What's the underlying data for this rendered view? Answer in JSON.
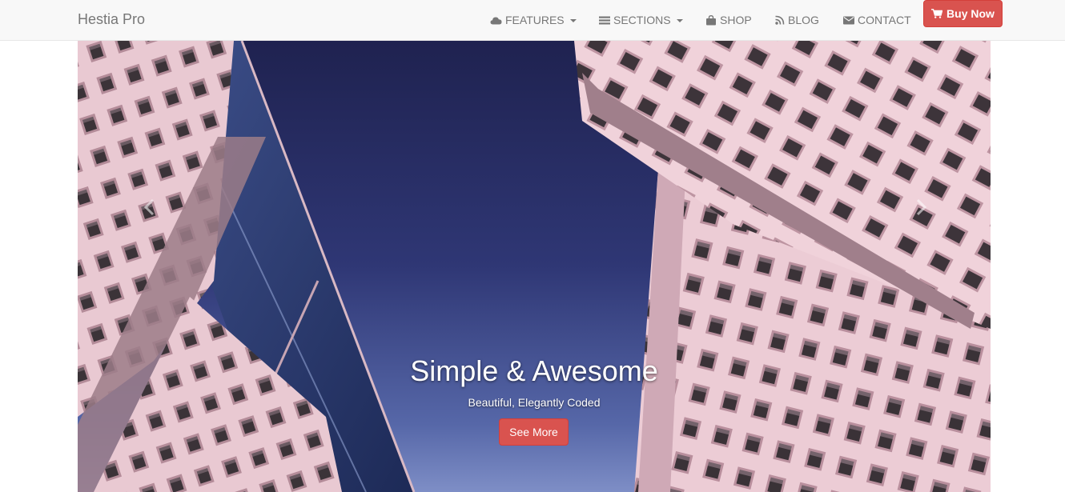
{
  "brand": {
    "name": "Hestia Pro"
  },
  "nav": {
    "items": [
      {
        "label": "FEATURES",
        "icon": "cloud-icon",
        "dropdown": true
      },
      {
        "label": "SECTIONS",
        "icon": "list-icon",
        "dropdown": true
      },
      {
        "label": "SHOP",
        "icon": "shopping-bag-icon",
        "dropdown": false
      },
      {
        "label": "BLOG",
        "icon": "rss-icon",
        "dropdown": false
      },
      {
        "label": "CONTACT",
        "icon": "envelope-icon",
        "dropdown": false
      }
    ],
    "cta": {
      "label": "Buy Now",
      "icon": "cart-icon"
    }
  },
  "hero": {
    "title": "Simple & Awesome",
    "subtitle": "Beautiful, Elegantly Coded",
    "button_label": "See More"
  },
  "colors": {
    "accent": "#d9534f",
    "nav_bg": "#f8f8f8",
    "nav_text": "#777777",
    "sky": "#2d3470",
    "building": "#e8c6d0"
  }
}
